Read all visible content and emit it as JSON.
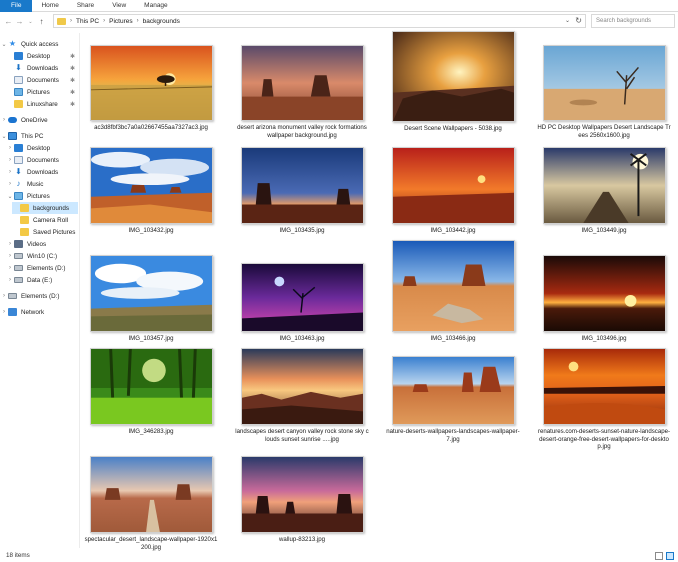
{
  "ribbon": {
    "tabs": [
      "File",
      "Home",
      "Share",
      "View",
      "Manage"
    ]
  },
  "address": {
    "crumbs": [
      "This PC",
      "Pictures",
      "backgrounds"
    ],
    "search_placeholder": "Search backgrounds"
  },
  "sidebar": {
    "quick_access": "Quick access",
    "qa_desktop": "Desktop",
    "qa_downloads": "Downloads",
    "qa_documents": "Documents",
    "qa_pictures": "Pictures",
    "qa_linuxshare": "Linuxshare",
    "onedrive": "OneDrive",
    "this_pc": "This PC",
    "pc_desktop": "Desktop",
    "pc_documents": "Documents",
    "pc_downloads": "Downloads",
    "pc_music": "Music",
    "pc_pictures": "Pictures",
    "pic_backgrounds": "backgrounds",
    "pic_camera_roll": "Camera Roll",
    "pic_saved": "Saved Pictures",
    "pc_videos": "Videos",
    "drive_c": "Win10 (C:)",
    "drive_d": "Elements (D:)",
    "drive_e": "Data (E:)",
    "elements_d": "Elements (D:)",
    "network": "Network"
  },
  "files": [
    {
      "name": "ac3d8fbf3bc7a0a02667455aa7327ac3.jpg",
      "scene": "wheat-sunset"
    },
    {
      "name": "desert arizona monument valley rock formations wallpaper background.jpg",
      "scene": "monument-dusk"
    },
    {
      "name": "Desert Scene Wallpapers - 5038.jpg",
      "scene": "sun-rays"
    },
    {
      "name": "HD PC Desktop Wallpapers Desert Landscape Trees 2560x1600.jpg",
      "scene": "desert-trees"
    },
    {
      "name": "IMG_103432.jpg",
      "scene": "blue-sky-mesa"
    },
    {
      "name": "IMG_103435.jpg",
      "scene": "twilight-monument"
    },
    {
      "name": "IMG_103442.jpg",
      "scene": "red-sunset"
    },
    {
      "name": "IMG_103449.jpg",
      "scene": "railroad-sign"
    },
    {
      "name": "IMG_103457.jpg",
      "scene": "blue-clouds"
    },
    {
      "name": "IMG_103463.jpg",
      "scene": "purple-moon"
    },
    {
      "name": "IMG_103466.jpg",
      "scene": "desert-wood"
    },
    {
      "name": "IMG_103496.jpg",
      "scene": "dark-sunset"
    },
    {
      "name": "IMG_346283.jpg",
      "scene": "green-forest"
    },
    {
      "name": "landscapes desert canyon valley rock stone sky clouds sunset sunrise .....jpg",
      "scene": "canyon-sunrise"
    },
    {
      "name": "nature-deserts-wallpapers-landscapes-wallpaper-7.jpg",
      "scene": "red-rocks"
    },
    {
      "name": "renatures.com-deserts-sunset-nature-landscape-desert-orange-free-desert-wallpapers-for-desktop.jpg",
      "scene": "orange-desert"
    },
    {
      "name": "spectacular_desert_landscape-wallpaper-1920x1200.jpg",
      "scene": "road-monuments"
    },
    {
      "name": "wallup-83213.jpg",
      "scene": "pink-monument"
    }
  ],
  "status": {
    "count": "18 items"
  }
}
